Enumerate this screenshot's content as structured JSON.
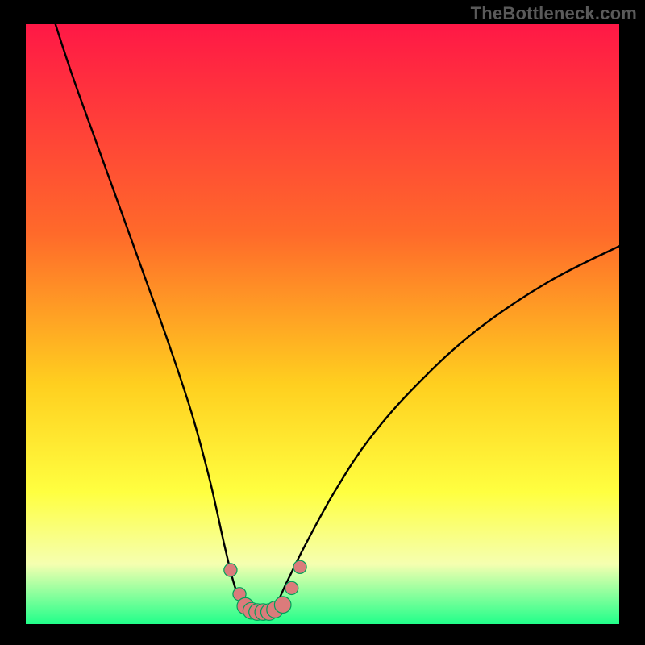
{
  "watermark": "TheBottleneck.com",
  "colors": {
    "gradient_top": "#ff1846",
    "gradient_mid1": "#ff6a2a",
    "gradient_mid2": "#ffcf1f",
    "gradient_mid3": "#ffff40",
    "gradient_mid4": "#f5ffb0",
    "gradient_bottom": "#21ff8a",
    "curve_stroke": "#000000",
    "marker_fill": "#db7b7b",
    "marker_stroke": "#00a05a",
    "frame_bg": "#000000"
  },
  "chart_data": {
    "type": "line",
    "title": "",
    "xlabel": "",
    "ylabel": "",
    "xlim": [
      0,
      100
    ],
    "ylim": [
      0,
      100
    ],
    "grid": false,
    "legend": false,
    "series": [
      {
        "name": "bottleneck-curve",
        "x": [
          5,
          8,
          12,
          16,
          20,
          24,
          28,
          31,
          33.5,
          35,
          36.5,
          38,
          40,
          42,
          44,
          47,
          52,
          58,
          66,
          76,
          88,
          100
        ],
        "y": [
          100,
          91,
          80,
          69,
          58,
          47,
          35,
          24,
          13,
          7,
          3,
          1.5,
          1.5,
          3,
          7,
          13,
          22,
          31,
          40,
          49,
          57,
          63
        ]
      }
    ],
    "markers": {
      "name": "highlighted-points",
      "x": [
        34.5,
        36,
        37,
        38,
        39,
        40,
        41,
        42,
        43.3,
        44.8,
        46.2
      ],
      "y": [
        9,
        5,
        3,
        2.2,
        2,
        2,
        2,
        2.4,
        3.2,
        6,
        9.5
      ],
      "r": [
        1.1,
        1.1,
        1.4,
        1.4,
        1.4,
        1.4,
        1.4,
        1.4,
        1.4,
        1.1,
        1.1
      ]
    }
  }
}
